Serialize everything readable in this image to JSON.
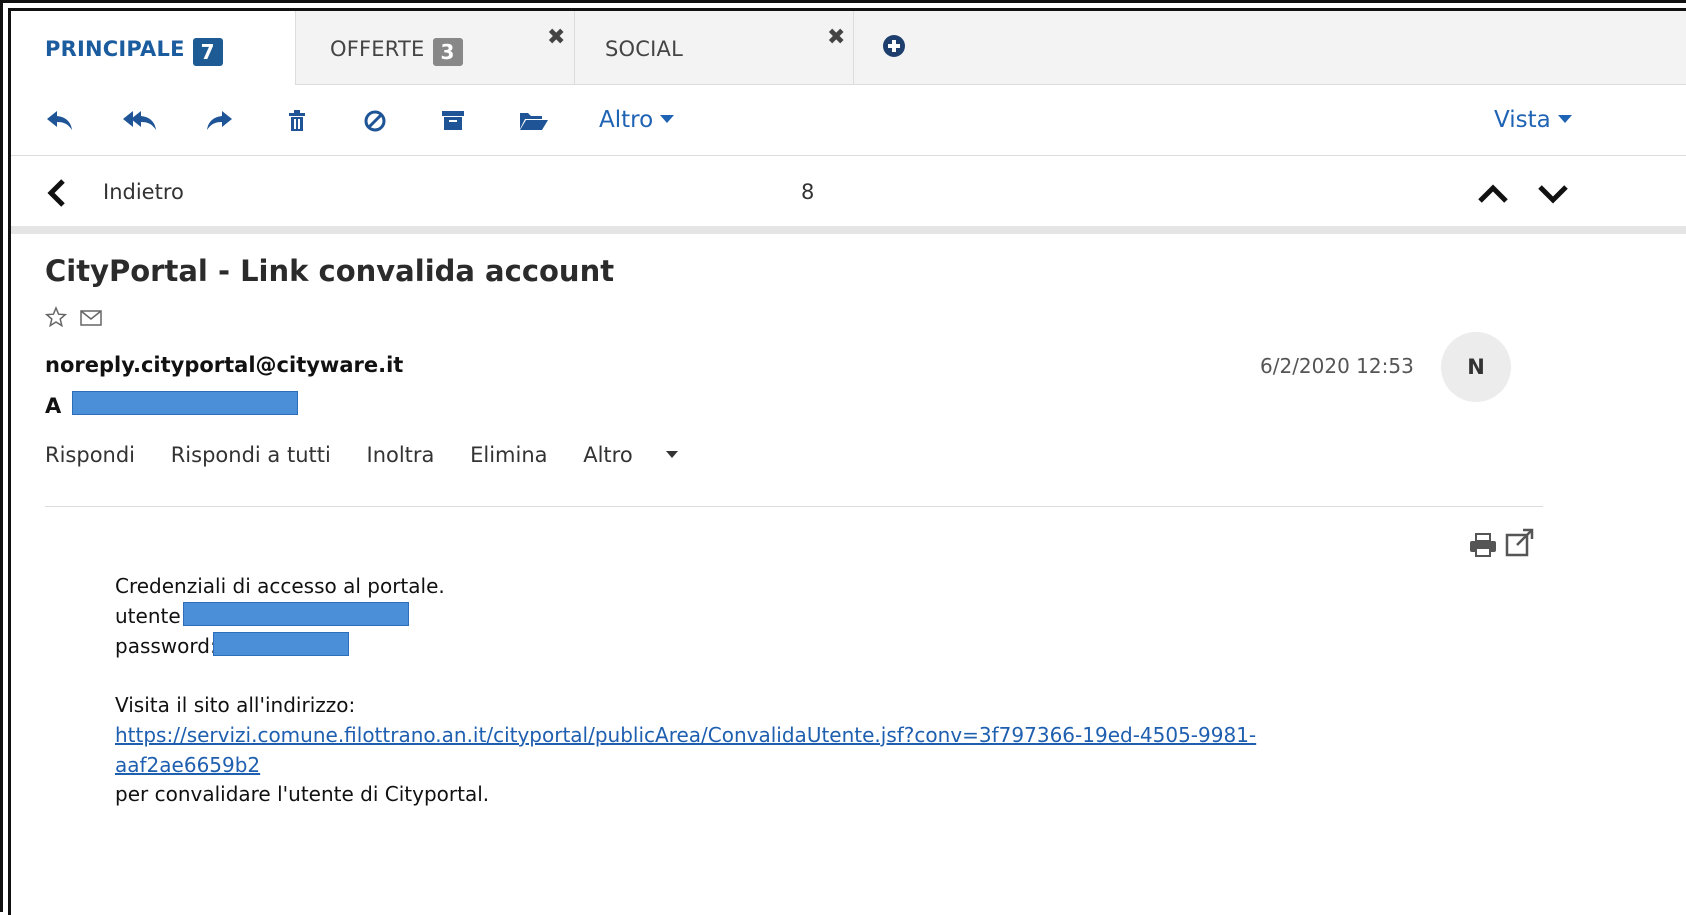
{
  "tabs": [
    {
      "label": "PRINCIPALE",
      "badge": "7"
    },
    {
      "label": "OFFERTE",
      "badge": "3"
    },
    {
      "label": "SOCIAL"
    }
  ],
  "toolbar": {
    "more_label": "Altro",
    "view_label": "Vista"
  },
  "nav": {
    "back_label": "Indietro",
    "count": "8"
  },
  "message": {
    "subject": "CityPortal - Link convalida account",
    "sender": "noreply.cityportal@cityware.it",
    "date": "6/2/2020 12:53",
    "avatar_initial": "N",
    "to_label": "A",
    "actions": {
      "reply": "Rispondi",
      "reply_all": "Rispondi a tutti",
      "forward": "Inoltra",
      "delete": "Elimina",
      "more": "Altro"
    },
    "body": {
      "line1": "Credenziali di accesso al portale.",
      "user_label": "utente:",
      "password_label": "password:",
      "visit_text": "Visita il sito all'indirizzo:",
      "link_line1": "https://servizi.comune.filottrano.an.it/cityportal/publicArea/ConvalidaUtente.jsf?conv=3f797366-19ed-4505-9981-",
      "link_line2": "aaf2ae6659b2",
      "closing": "per convalidare l'utente di Cityportal."
    }
  },
  "colors": {
    "accent": "#1f63b4",
    "active_tab": "#1b5c9e",
    "redaction": "#4a8fd8"
  }
}
